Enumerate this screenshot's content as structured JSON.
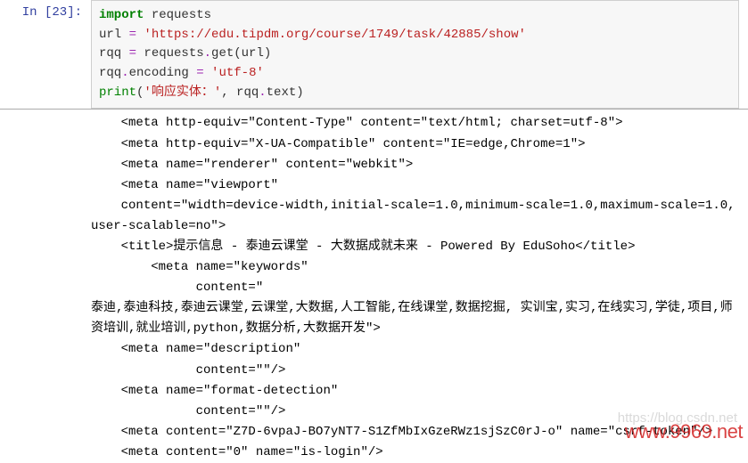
{
  "cell": {
    "prompt": "In [23]:",
    "code": {
      "line1": {
        "import": "import",
        "mod": " requests"
      },
      "line2": {
        "var": "url ",
        "op": "=",
        "sp": " ",
        "str": "'https://edu.tipdm.org/course/1749/task/42885/show'"
      },
      "line3": {
        "a": "rqq ",
        "op": "=",
        "b": " requests",
        "c": ".",
        "d": "get(url)"
      },
      "line4": {
        "a": "rqq",
        "b": ".",
        "c": "encoding ",
        "op": "=",
        "str": " 'utf-8'"
      },
      "line5": {
        "fn": "print",
        "p1": "(",
        "str": "'响应实体：'",
        "p2": ",",
        "r": " rqq",
        "dot": ".",
        "t": "text)"
      }
    },
    "output": "    <meta http-equiv=\"Content-Type\" content=\"text/html; charset=utf-8\">\n    <meta http-equiv=\"X-UA-Compatible\" content=\"IE=edge,Chrome=1\">\n    <meta name=\"renderer\" content=\"webkit\">\n    <meta name=\"viewport\"\n    content=\"width=device-width,initial-scale=1.0,minimum-scale=1.0,maximum-scale=1.0,user-scalable=no\">\n    <title>提示信息 - 泰迪云课堂 - 大数据成就未来 - Powered By EduSoho</title>\n        <meta name=\"keywords\"\n              content=\"\n泰迪,泰迪科技,泰迪云课堂,云课堂,大数据,人工智能,在线课堂,数据挖掘, 实训宝,实习,在线实习,学徒,项目,师资培训,就业培训,python,数据分析,大数据开发\">\n    <meta name=\"description\"\n              content=\"\"/>\n    <meta name=\"format-detection\"\n              content=\"\"/>\n    <meta content=\"Z7D-6vpaJ-BO7yNT7-S1ZfMbIxGzeRWz1sjSzC0rJ-o\" name=\"csrf-token\"/>\n    <meta content=\"0\" name=\"is-login\"/>"
  },
  "watermark1": "https://blog.csdn.net",
  "watermark2": "www.9969.net"
}
